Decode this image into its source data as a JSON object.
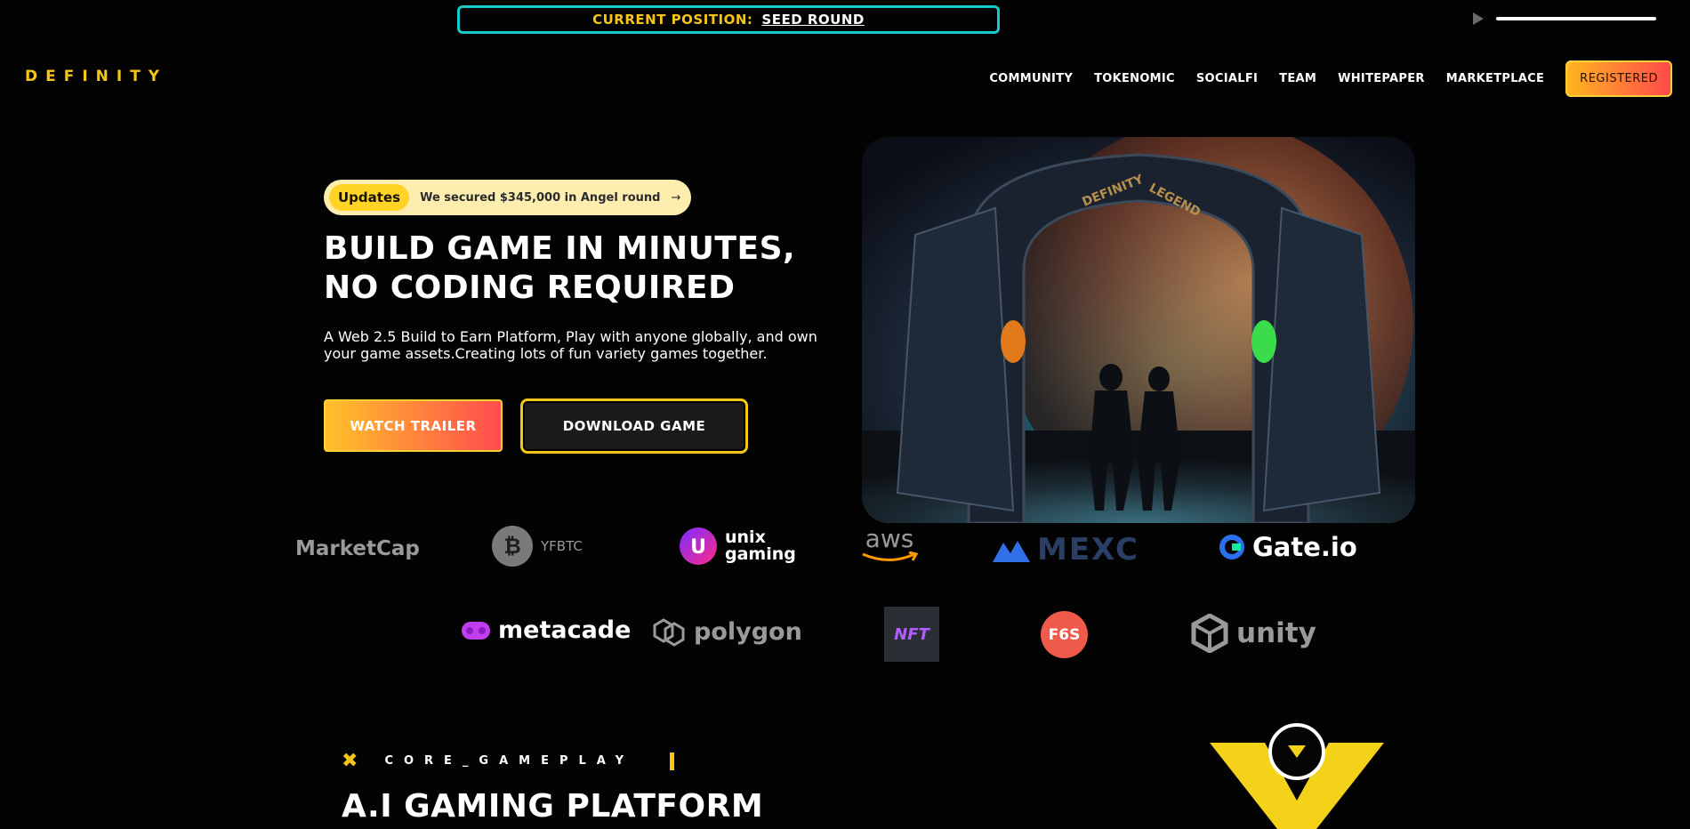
{
  "banner": {
    "label": "CURRENT POSITION:",
    "value": "SEED ROUND"
  },
  "audio": {
    "play_icon": "play-icon"
  },
  "header": {
    "logo": "DEFINITY",
    "nav": [
      "COMMUNITY",
      "TOKENOMIC",
      "SOCIALFI",
      "TEAM",
      "WHITEPAPER",
      "MARKETPLACE"
    ],
    "cta": "REGISTERED"
  },
  "hero": {
    "update_tag": "Updates",
    "update_text": "We secured $345,000 in Angel round",
    "title_line1": "BUILD GAME IN MINUTES,",
    "title_line2": "NO CODING REQUIRED",
    "subtitle": "A Web 2.5 Build to Earn Platform, Play with anyone globally, and own your game assets.Creating lots of fun variety games together.",
    "btn_trailer": "WATCH TRAILER",
    "btn_download": "DOWNLOAD GAME",
    "art_gate_text": "DEFINITY LEGEND"
  },
  "partners_row1": [
    "MarketCap",
    "YFBTC",
    "unix",
    "gaming",
    "aws",
    "MEXC",
    "Gate.io"
  ],
  "partners_row2": [
    "metacade",
    "polygon",
    "NFT",
    "F6S",
    "unity"
  ],
  "gameplay": {
    "label": "CORE_GAMEPLAY",
    "title": "A.I GAMING PLATFORM"
  },
  "colors": {
    "accent": "#f5c518",
    "teal": "#17c9c9",
    "gradient_start": "#ffc12a",
    "gradient_end": "#ff4d4d"
  }
}
